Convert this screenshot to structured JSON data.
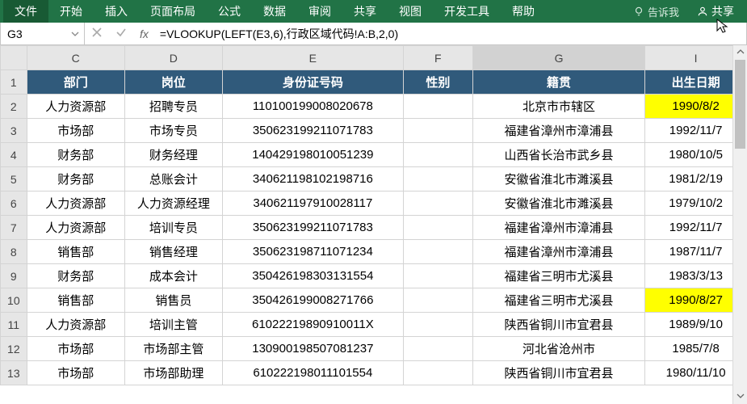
{
  "ribbon": {
    "tabs": [
      "文件",
      "开始",
      "插入",
      "页面布局",
      "公式",
      "数据",
      "审阅",
      "共享",
      "视图",
      "开发工具",
      "帮助"
    ],
    "tell_me": "告诉我",
    "share": "共享"
  },
  "formula_bar": {
    "name_box": "G3",
    "fx_label": "fx",
    "formula": "=VLOOKUP(LEFT(E3,6),行政区域代码!A:B,2,0)"
  },
  "columns": [
    {
      "letter": "C",
      "width": "col-C"
    },
    {
      "letter": "D",
      "width": "col-D"
    },
    {
      "letter": "E",
      "width": "col-E"
    },
    {
      "letter": "F",
      "width": "col-F"
    },
    {
      "letter": "G",
      "width": "col-G"
    },
    {
      "letter": "I",
      "width": "col-I"
    }
  ],
  "selected_col": "G",
  "header_row_number": "1",
  "headers": {
    "C": "部门",
    "D": "岗位",
    "E": "身份证号码",
    "F": "性别",
    "G": "籍贯",
    "I": "出生日期"
  },
  "rows": [
    {
      "n": "2",
      "C": "人力资源部",
      "D": "招聘专员",
      "E": "110100199008020678",
      "F": "",
      "G": "北京市市辖区",
      "I": "1990/8/2",
      "hi": true
    },
    {
      "n": "3",
      "C": "市场部",
      "D": "市场专员",
      "E": "350623199211071783",
      "F": "",
      "G": "福建省漳州市漳浦县",
      "I": "1992/11/7"
    },
    {
      "n": "4",
      "C": "财务部",
      "D": "财务经理",
      "E": "140429198010051239",
      "F": "",
      "G": "山西省长治市武乡县",
      "I": "1980/10/5"
    },
    {
      "n": "5",
      "C": "财务部",
      "D": "总账会计",
      "E": "340621198102198716",
      "F": "",
      "G": "安徽省淮北市濉溪县",
      "I": "1981/2/19"
    },
    {
      "n": "6",
      "C": "人力资源部",
      "D": "人力资源经理",
      "E": "340621197910028117",
      "F": "",
      "G": "安徽省淮北市濉溪县",
      "I": "1979/10/2"
    },
    {
      "n": "7",
      "C": "人力资源部",
      "D": "培训专员",
      "E": "350623199211071783",
      "F": "",
      "G": "福建省漳州市漳浦县",
      "I": "1992/11/7"
    },
    {
      "n": "8",
      "C": "销售部",
      "D": "销售经理",
      "E": "350623198711071234",
      "F": "",
      "G": "福建省漳州市漳浦县",
      "I": "1987/11/7"
    },
    {
      "n": "9",
      "C": "财务部",
      "D": "成本会计",
      "E": "350426198303131554",
      "F": "",
      "G": "福建省三明市尤溪县",
      "I": "1983/3/13"
    },
    {
      "n": "10",
      "C": "销售部",
      "D": "销售员",
      "E": "350426199008271766",
      "F": "",
      "G": "福建省三明市尤溪县",
      "I": "1990/8/27",
      "hi": true
    },
    {
      "n": "11",
      "C": "人力资源部",
      "D": "培训主管",
      "E": "61022219890910011X",
      "F": "",
      "G": "陕西省铜川市宜君县",
      "I": "1989/9/10"
    },
    {
      "n": "12",
      "C": "市场部",
      "D": "市场部主管",
      "E": "130900198507081237",
      "F": "",
      "G": "河北省沧州市",
      "I": "1985/7/8"
    },
    {
      "n": "13",
      "C": "市场部",
      "D": "市场部助理",
      "E": "610222198011101554",
      "F": "",
      "G": "陕西省铜川市宜君县",
      "I": "1980/11/10"
    }
  ]
}
